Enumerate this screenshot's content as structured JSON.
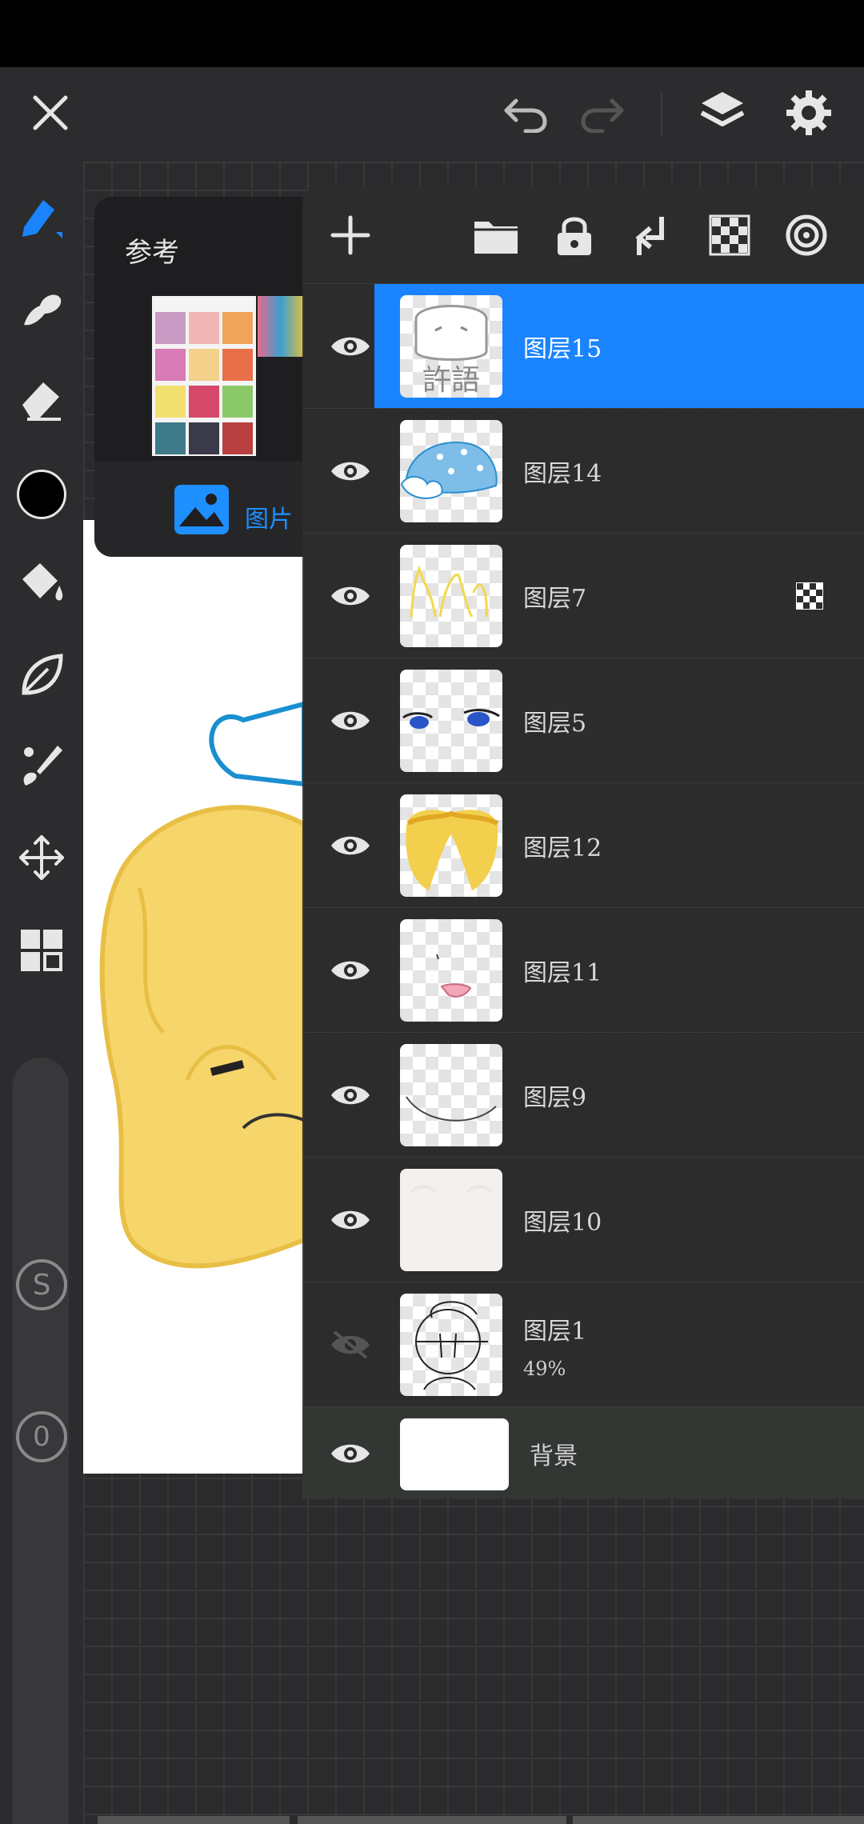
{
  "app": {
    "accent": "#1a84ff",
    "bg": "#2c2c2e"
  },
  "topbar": {
    "close_icon": "close-icon",
    "undo_icon": "undo-icon",
    "redo_icon": "redo-icon",
    "layers_icon": "layers-icon",
    "settings_icon": "gear-icon"
  },
  "toolbar": {
    "tools": [
      "pen-icon",
      "smudge-icon",
      "eraser-icon",
      "color-swatch",
      "fill-bucket-icon",
      "leaf-icon",
      "brush-icon",
      "move-icon",
      "grid-icon"
    ],
    "current_color": "#000000",
    "size_badge": "S",
    "opacity_badge": "0"
  },
  "reference": {
    "title": "参考",
    "image_label": "图片"
  },
  "layers_panel": {
    "actions": [
      "add-layer-icon",
      "folder-icon",
      "lock-icon",
      "merge-down-icon",
      "alpha-lock-icon",
      "target-icon"
    ],
    "layers": [
      {
        "name": "图层15",
        "selected": true,
        "visible": true,
        "opacity": ""
      },
      {
        "name": "图层14",
        "selected": false,
        "visible": true,
        "opacity": ""
      },
      {
        "name": "图层7",
        "selected": false,
        "visible": true,
        "opacity": "",
        "alpha_lock": true
      },
      {
        "name": "图层5",
        "selected": false,
        "visible": true,
        "opacity": ""
      },
      {
        "name": "图层12",
        "selected": false,
        "visible": true,
        "opacity": ""
      },
      {
        "name": "图层11",
        "selected": false,
        "visible": true,
        "opacity": ""
      },
      {
        "name": "图层9",
        "selected": false,
        "visible": true,
        "opacity": ""
      },
      {
        "name": "图层10",
        "selected": false,
        "visible": true,
        "opacity": ""
      },
      {
        "name": "图层1",
        "selected": false,
        "visible": false,
        "opacity": "49%"
      },
      {
        "name": "背景",
        "selected": false,
        "visible": true,
        "opacity": ""
      }
    ]
  },
  "stamp_text": "許語"
}
